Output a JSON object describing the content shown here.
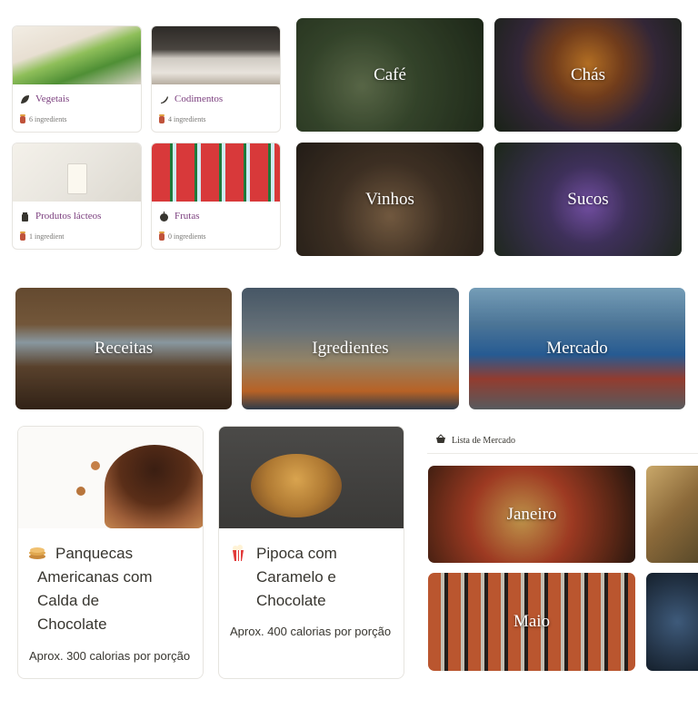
{
  "categories": [
    {
      "label": "Vegetais",
      "count": "6 ingredients",
      "icon": "leaf-icon"
    },
    {
      "label": "Codimentos",
      "count": "4 ingredients",
      "icon": "pepper-icon"
    },
    {
      "label": "Produtos lácteos",
      "count": "1 ingredient",
      "icon": "milk-bottle-icon"
    },
    {
      "label": "Frutas",
      "count": "0 ingredients",
      "icon": "fruit-icon"
    }
  ],
  "drinks": [
    "Café",
    "Chás",
    "Vinhos",
    "Sucos"
  ],
  "sections": [
    "Receitas",
    "Igredientes",
    "Mercado"
  ],
  "recipes": [
    {
      "title_lines": [
        "Panquecas",
        "Americanas com",
        "Calda de",
        "Chocolate"
      ],
      "calories": "Aprox. 300 calorias por porção",
      "icon": "pancake-icon"
    },
    {
      "title_lines": [
        "Pipoca com",
        "Caramelo e",
        "Chocolate"
      ],
      "calories": "Aprox. 400 calorias por porção",
      "icon": "popcorn-icon"
    }
  ],
  "shopping": {
    "header": "Lista de Mercado",
    "months": [
      "Janeiro",
      "Maio"
    ]
  },
  "colors": {
    "category_text": "#7b3f7e",
    "muted": "#787774",
    "border": "#e6e4df"
  }
}
